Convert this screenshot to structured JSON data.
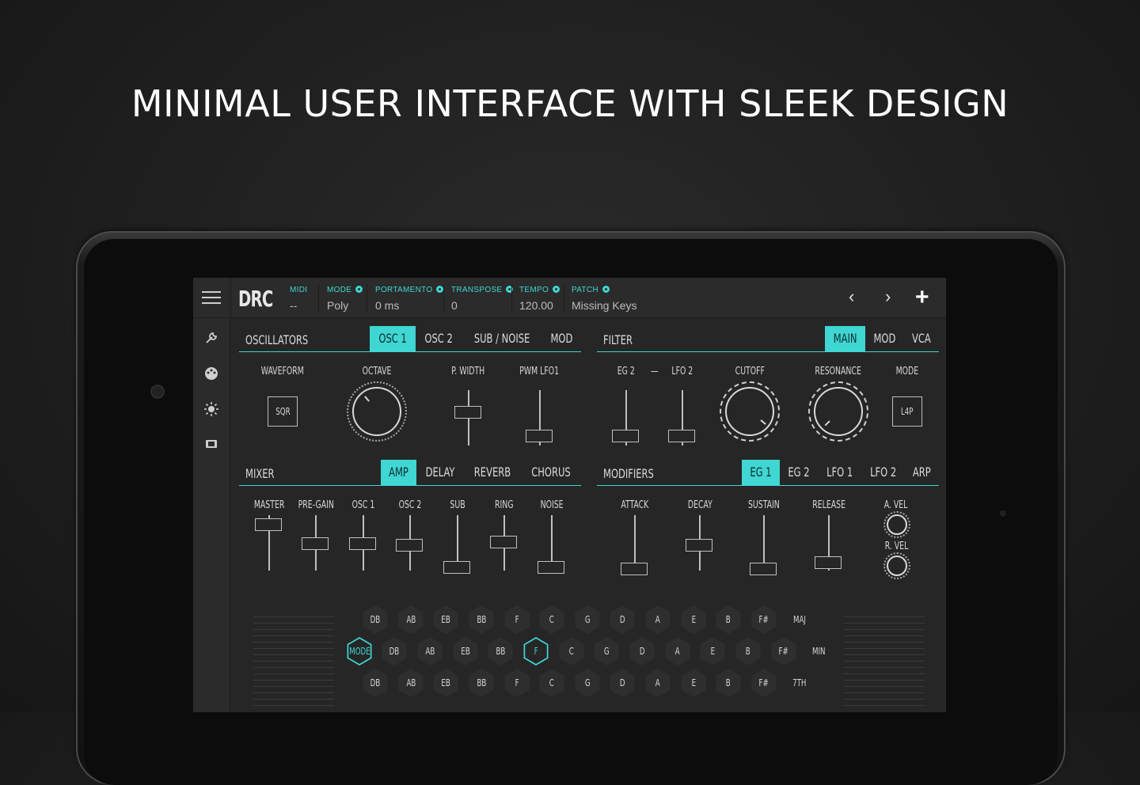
{
  "headline": "MINIMAL USER INTERFACE WITH SLEEK DESIGN",
  "colors": {
    "accent": "#3fd6d3",
    "panel": "#262626",
    "background": "#1f1f1f"
  },
  "app": {
    "title": "DRC"
  },
  "topbar": {
    "params": [
      {
        "label": "MIDI",
        "value": "--",
        "gear": false
      },
      {
        "label": "MODE",
        "value": "Poly",
        "gear": true
      },
      {
        "label": "PORTAMENTO",
        "value": "0 ms",
        "gear": true
      },
      {
        "label": "TRANSPOSE",
        "value": "0",
        "gear": true
      },
      {
        "label": "TEMPO",
        "value": "120.00",
        "gear": true
      },
      {
        "label": "PATCH",
        "value": "Missing Keys",
        "gear": true
      }
    ],
    "prev": "‹",
    "next": "›",
    "add": "+"
  },
  "sidebar": {
    "icons": [
      "wrench-icon",
      "palette-icon",
      "brightness-icon",
      "film-icon"
    ]
  },
  "oscillators": {
    "title": "OSCILLATORS",
    "tabs": [
      "OSC 1",
      "OSC 2",
      "SUB / NOISE",
      "MOD"
    ],
    "active_tab": "OSC 1",
    "labels": {
      "waveform": "WAVEFORM",
      "octave": "OCTAVE",
      "pwidth": "P. WIDTH",
      "pwm": "PWM LFO1"
    },
    "waveform_value": "SQR"
  },
  "filter": {
    "title": "FILTER",
    "tabs": [
      "MAIN",
      "MOD",
      "VCA"
    ],
    "active_tab": "MAIN",
    "labels": {
      "eg2": "EG 2",
      "dash": "—",
      "lfo2": "LFO 2",
      "cutoff": "CUTOFF",
      "resonance": "RESONANCE",
      "mode": "MODE"
    },
    "mode_value": "L4P"
  },
  "mixer": {
    "title": "MIXER",
    "tabs": [
      "AMP",
      "DELAY",
      "REVERB",
      "CHORUS"
    ],
    "active_tab": "AMP",
    "channels": [
      "MASTER",
      "PRE-GAIN",
      "OSC 1",
      "OSC 2",
      "SUB",
      "RING",
      "NOISE"
    ]
  },
  "modifiers": {
    "title": "MODIFIERS",
    "tabs": [
      "EG 1",
      "EG 2",
      "LFO 1",
      "LFO 2",
      "ARP"
    ],
    "active_tab": "EG 1",
    "params": [
      "ATTACK",
      "DECAY",
      "SUSTAIN",
      "RELEASE"
    ],
    "a_vel": "A. VEL",
    "r_vel": "R. VEL"
  },
  "keyboard": {
    "mode_label": "MODE",
    "row1": [
      "DB",
      "AB",
      "EB",
      "BB",
      "F",
      "C",
      "G",
      "D",
      "A",
      "E",
      "B",
      "F#"
    ],
    "row1_type": "MAJ",
    "row2": [
      "DB",
      "AB",
      "EB",
      "BB",
      "F",
      "C",
      "G",
      "D",
      "A",
      "E",
      "B",
      "F#"
    ],
    "row2_type": "MIN",
    "row3": [
      "DB",
      "AB",
      "EB",
      "BB",
      "F",
      "C",
      "G",
      "D",
      "A",
      "E",
      "B",
      "F#"
    ],
    "row3_type": "7TH",
    "selected": "F"
  }
}
